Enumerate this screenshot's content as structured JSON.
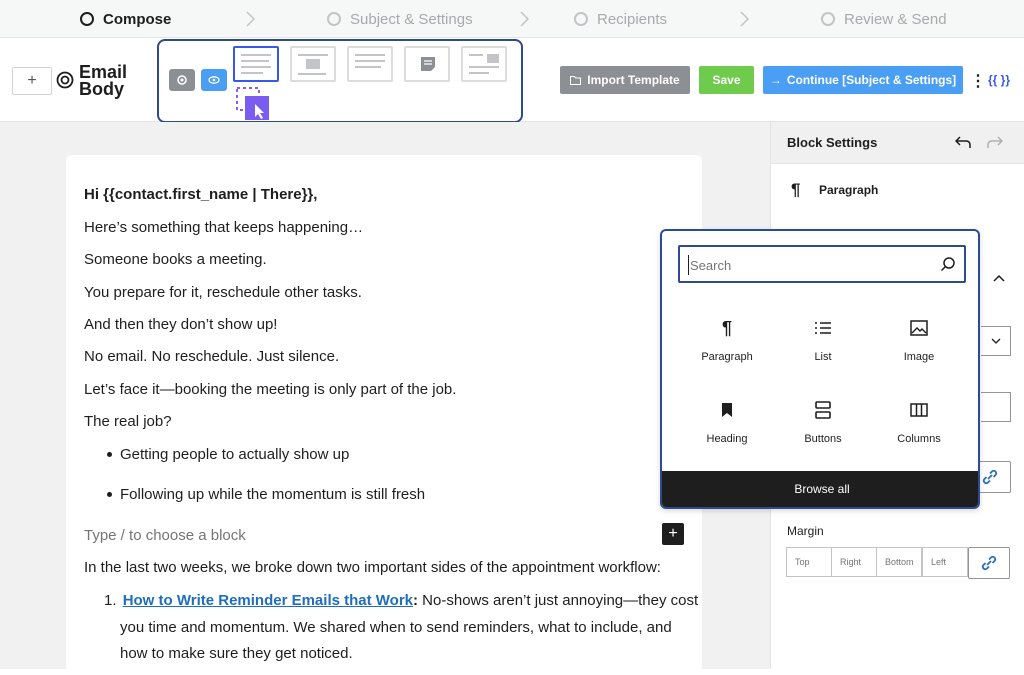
{
  "stepper": {
    "steps": [
      {
        "label": "Compose"
      },
      {
        "label": "Subject & Settings"
      },
      {
        "label": "Recipients"
      },
      {
        "label": "Review & Send"
      }
    ]
  },
  "topbar": {
    "add_label": "+",
    "title_line1": "Email",
    "title_line2": "Body",
    "import_label": "Import Template",
    "save_label": "Save",
    "continue_label": "Continue [Subject & Settings]",
    "more_label": "⋮",
    "merge_tags_label": "{{ }}"
  },
  "colors": {
    "accent": "#3858e9",
    "save_green": "#6fcb4b",
    "continue_blue": "#4a9ff5",
    "import_gray": "#8c8f94",
    "link_blue": "#1f6ebd",
    "highlight_border": "#2e4b8f"
  },
  "editor": {
    "greeting": "Hi {{contact.first_name | There}},",
    "lines": [
      "Here’s something that keeps happening…",
      "Someone books a meeting.",
      "You prepare for it, reschedule other tasks.",
      "And then they don’t show up!",
      "No email. No reschedule. Just silence.",
      "Let’s face it—booking the meeting is only part of the job.",
      "The real job?"
    ],
    "bullets": [
      "Getting people to actually show up",
      "Following up while the momentum is still fresh"
    ],
    "block_placeholder": "Type / to choose a block",
    "after_text": "In the last two weeks, we broke down two important sides of the appointment workflow:",
    "list_number": "1.",
    "list_link": "How to Write Reminder Emails that Work",
    "list_colon": ":",
    "list_text_1": " No-shows aren’t just annoying—they cost",
    "list_text_2": "you time and momentum. We shared when to send reminders, what to include, and",
    "list_text_3": "how to make sure they get noticed."
  },
  "sidebar": {
    "header": "Block Settings",
    "block_name": "Paragraph",
    "margin_label": "Margin",
    "margin_fields": [
      "Top",
      "Right",
      "Bottom",
      "Left"
    ]
  },
  "inserter": {
    "search_placeholder": "Search",
    "blocks": [
      {
        "label": "Paragraph",
        "icon": "paragraph-icon"
      },
      {
        "label": "List",
        "icon": "list-icon"
      },
      {
        "label": "Image",
        "icon": "image-icon"
      },
      {
        "label": "Heading",
        "icon": "bookmark-icon"
      },
      {
        "label": "Buttons",
        "icon": "buttons-icon"
      },
      {
        "label": "Columns",
        "icon": "columns-icon"
      }
    ],
    "browse_all": "Browse all"
  }
}
